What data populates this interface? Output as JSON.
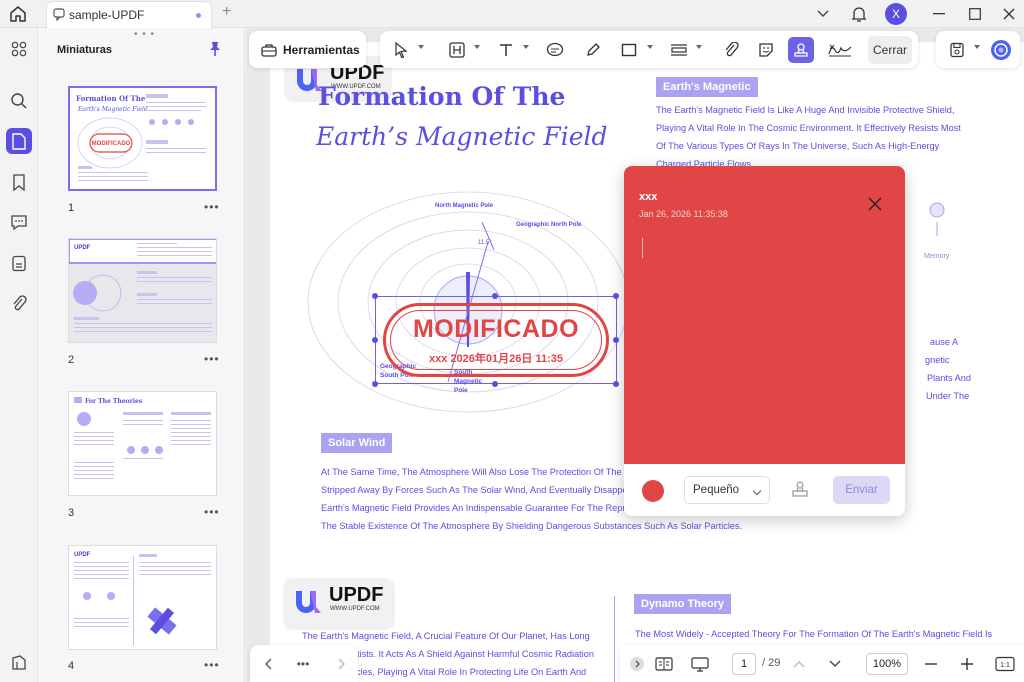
{
  "tab": {
    "title": "sample-UPDF"
  },
  "sidebar": {
    "title": "Miniaturas"
  },
  "thumbnails": [
    {
      "number": "1"
    },
    {
      "number": "2"
    },
    {
      "number": "3"
    },
    {
      "number": "4"
    }
  ],
  "thumb_text": {
    "p1_stamp": "MODIFICADO",
    "p3_title": "For The Theories"
  },
  "avatar": {
    "initial": "X"
  },
  "toolbar": {
    "tools_label": "Herramientas",
    "close_label": "Cerrar"
  },
  "document": {
    "title_line1": "Formation Of The",
    "title_line2": "Earth’s Magnetic Field",
    "logo_name": "UPDF",
    "logo_url": "WWW.UPDF.COM",
    "section_magnetic": "Earth's Magnetic",
    "magnetic_lines": [
      "The Earth's Magnetic Field Is Like A Huge And Invisible Protective Shield,",
      "Playing A Vital Role In The Cosmic Environment. It Effectively Resists Most",
      "Of The Various Types Of Rays In The Universe, Such As High-Energy",
      "Charged Particle Flows"
    ],
    "right_fragments": [
      "ause A",
      "gnetic",
      "Plants And",
      "Under The"
    ],
    "memory_label": "Memory",
    "diagram_labels": {
      "north_magnetic": "North Magnetic Pole",
      "geo_north": "Geographic North Pole",
      "geo_south": "Geographic South Pole",
      "south_magnetic": "South Magnetic Pole",
      "angle": "11.5°"
    },
    "stamp": {
      "title": "MODIFICADO",
      "date": "xxx 2026年01月26日 11:35"
    },
    "section_solar": "Solar Wind",
    "solar_lines": [
      "At The Same Time, The Atmosphere Will Also Lose The Protection Of The Mag",
      "Stripped Away By Forces Such As The Solar Wind, And Eventually Disappear. I",
      "Earth's Magnetic Field Provides An Indispensable Guarantee For The Reproduc",
      "The Stable Existence Of The Atmosphere By Shielding Dangerous Substances Such As Solar Particles."
    ],
    "lower_left_lines": [
      "The Earth's Magnetic Field, A Crucial Feature Of Our Planet, Has Long",
      "tists. It Acts As A Shield Against Harmful Cosmic Radiation",
      "cles, Playing A Vital Role In Protecting Life On Earth And"
    ],
    "section_dynamo": "Dynamo Theory",
    "dynamo_line": "The Most Widely - Accepted Theory For The Formation Of The Earth's Magnetic Field Is"
  },
  "note": {
    "author": "xxx",
    "date": "Jan 26, 2026 11:35:38",
    "color": "#e04646",
    "size": "Pequeño",
    "send_label": "Enviar"
  },
  "bottom": {
    "page": "1",
    "total": "/ 29",
    "zoom": "100%"
  }
}
